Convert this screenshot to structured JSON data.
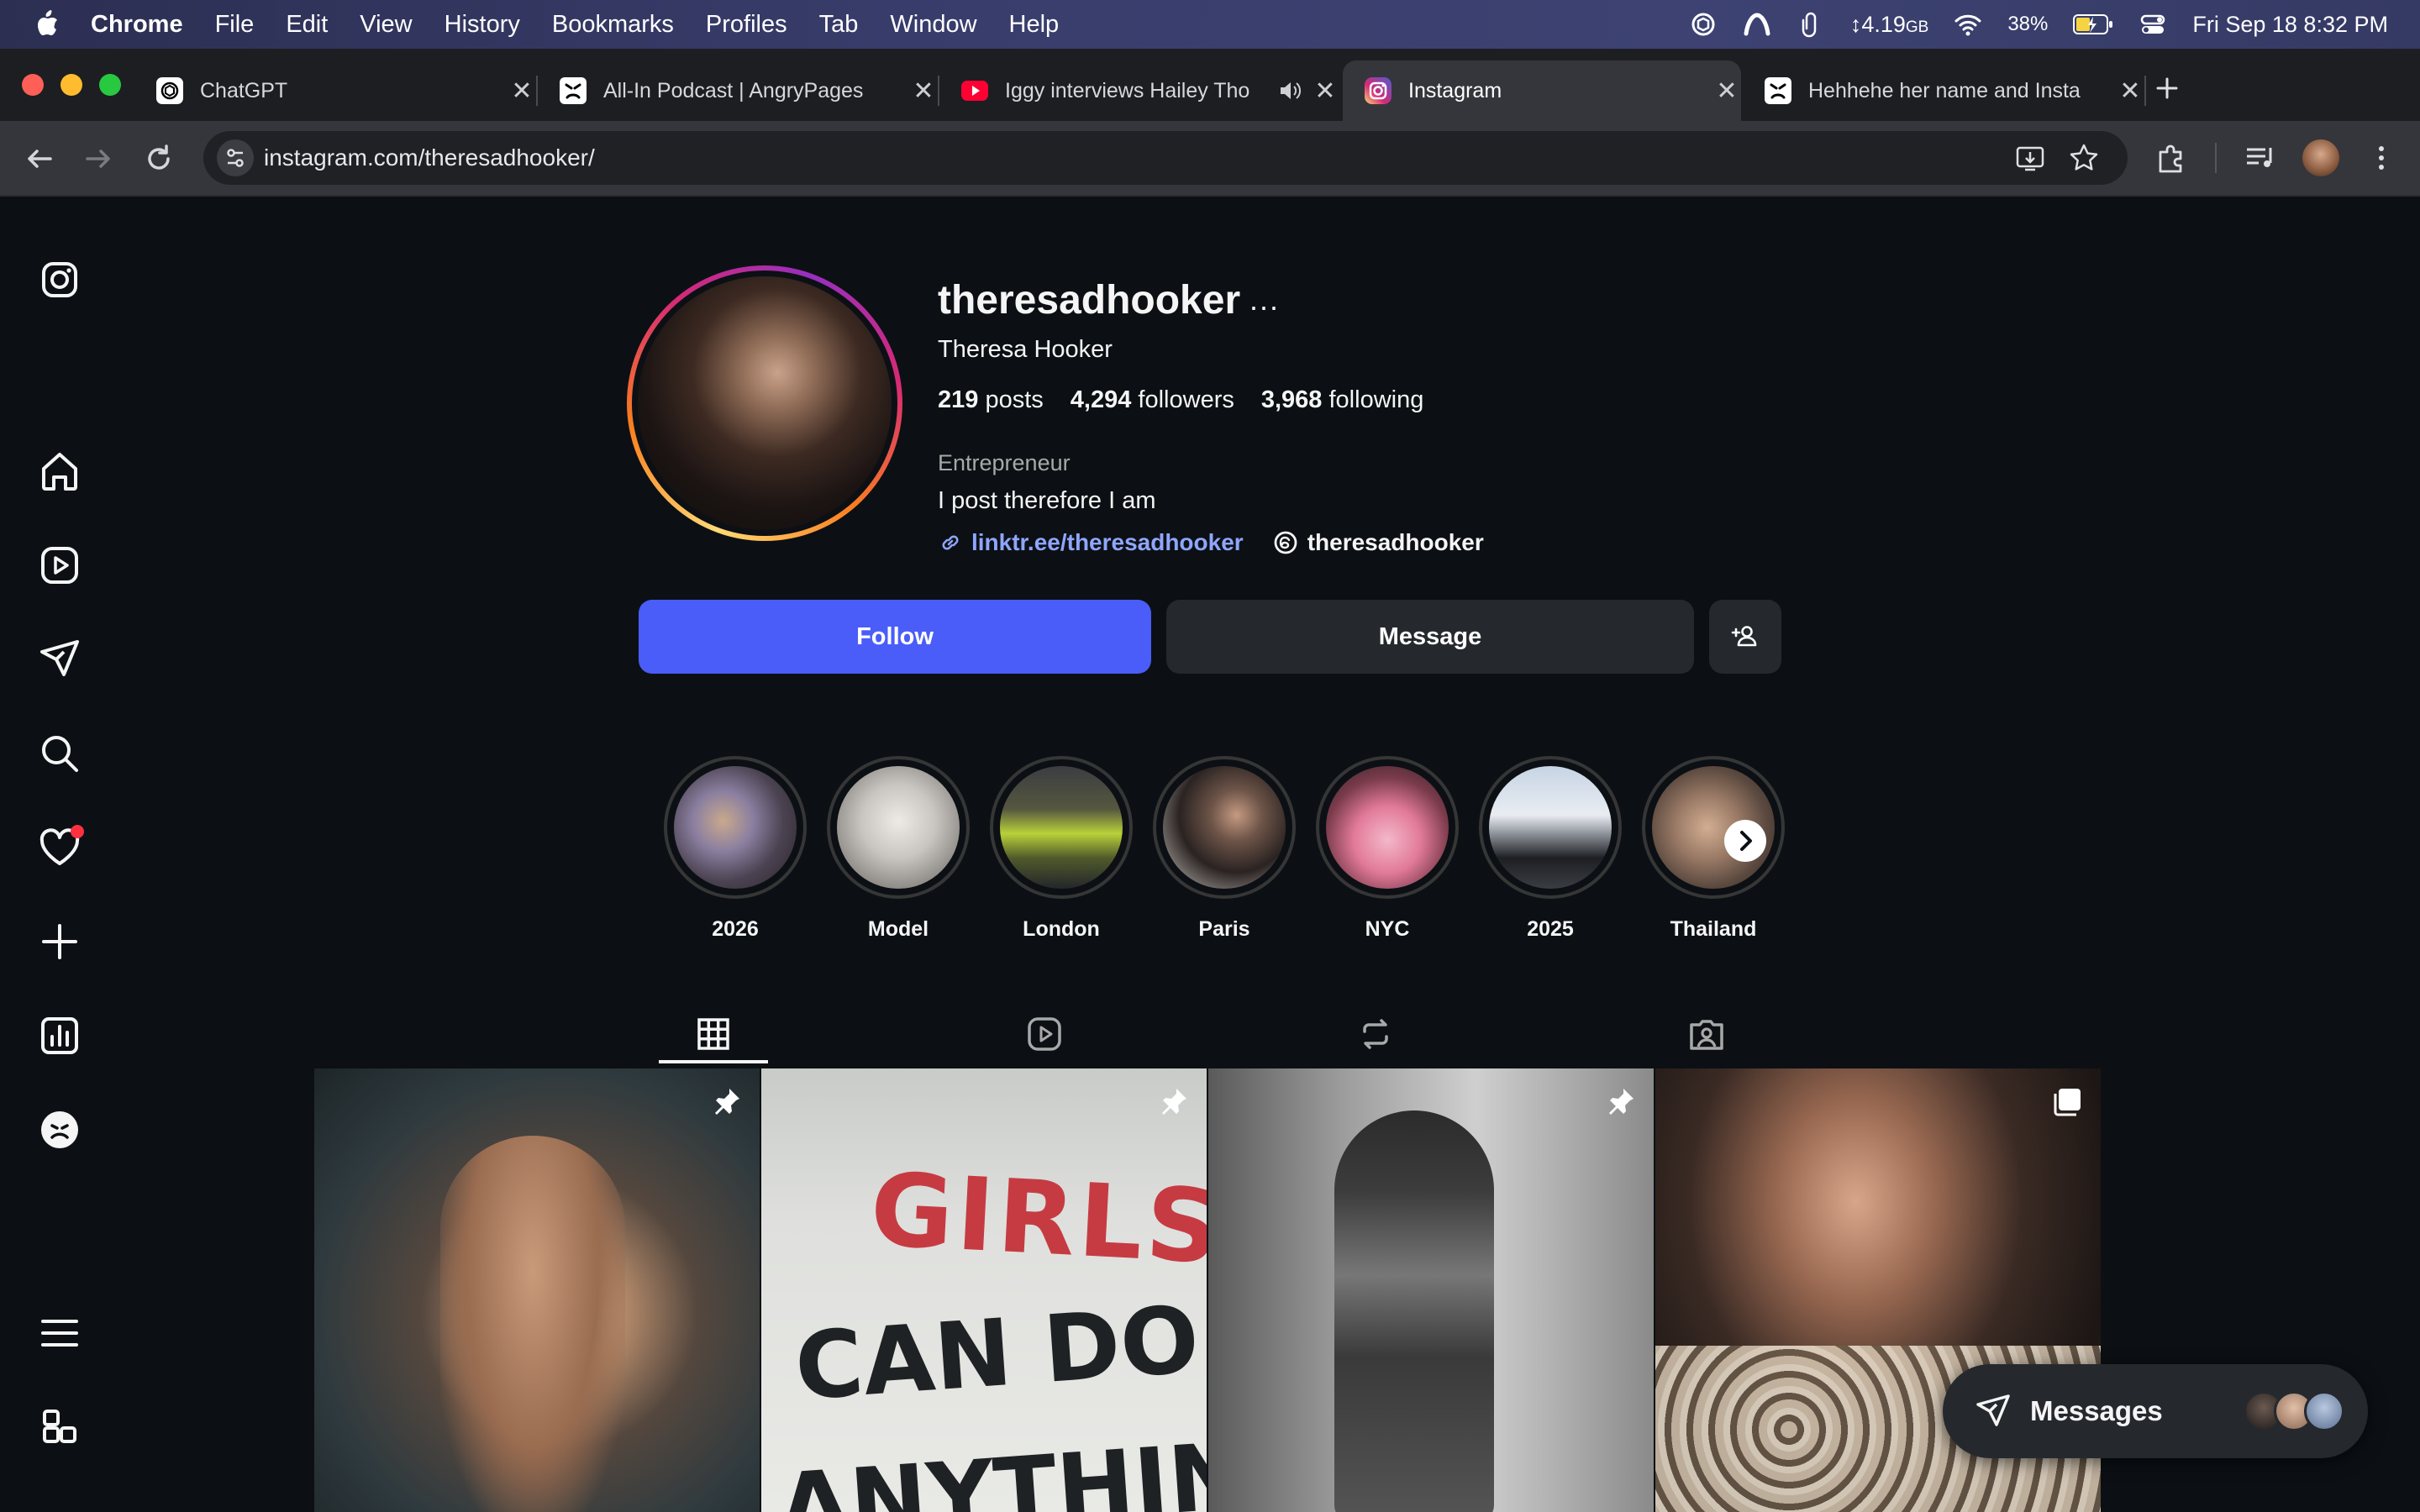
{
  "menubar": {
    "app": "Chrome",
    "items": [
      "File",
      "Edit",
      "View",
      "History",
      "Bookmarks",
      "Profiles",
      "Tab",
      "Window",
      "Help"
    ],
    "memory": "4.19",
    "memory_unit": "GB",
    "battery": "38%",
    "datetime": "Fri Sep 18  8:32 PM"
  },
  "tabs": [
    {
      "title": "ChatGPT",
      "icon": "chatgpt-icon"
    },
    {
      "title": "All-In Podcast | AngryPages",
      "icon": "angrypages-icon"
    },
    {
      "title": "Iggy interviews Hailey Tho",
      "icon": "youtube-icon"
    },
    {
      "title": "Instagram",
      "icon": "instagram-icon"
    },
    {
      "title": "Hehhehe her name and Insta",
      "icon": "angrypages-icon"
    }
  ],
  "omnibox": {
    "url": "instagram.com/theresadhooker/"
  },
  "profile": {
    "username": "theresadhooker",
    "more": "···",
    "full_name": "Theresa Hooker",
    "posts_count": "219",
    "posts_label": "posts",
    "followers_count": "4,294",
    "followers_label": "followers",
    "following_count": "3,968",
    "following_label": "following",
    "category": "Entrepreneur",
    "bio": "I post therefore I am",
    "link": "linktr.ee/theresadhooker",
    "threads": "theresadhooker"
  },
  "actions": {
    "follow": "Follow",
    "message": "Message"
  },
  "highlights": [
    "2026",
    "Model",
    "London",
    "Paris",
    "NYC",
    "2025",
    "Thailand"
  ],
  "grid_posts": [
    {
      "overlay": "pin-icon"
    },
    {
      "overlay": "pin-icon",
      "text_line1": "GIRLS",
      "text_line2": "CAN DO",
      "text_line3": "ANYTHIN"
    },
    {
      "overlay": "pin-icon"
    },
    {
      "overlay": "carousel-icon"
    }
  ],
  "messages": {
    "label": "Messages"
  },
  "colors": {
    "accent": "#4a5df9",
    "link": "#8fa6ff",
    "background": "#0c1014",
    "button": "#25292e"
  }
}
